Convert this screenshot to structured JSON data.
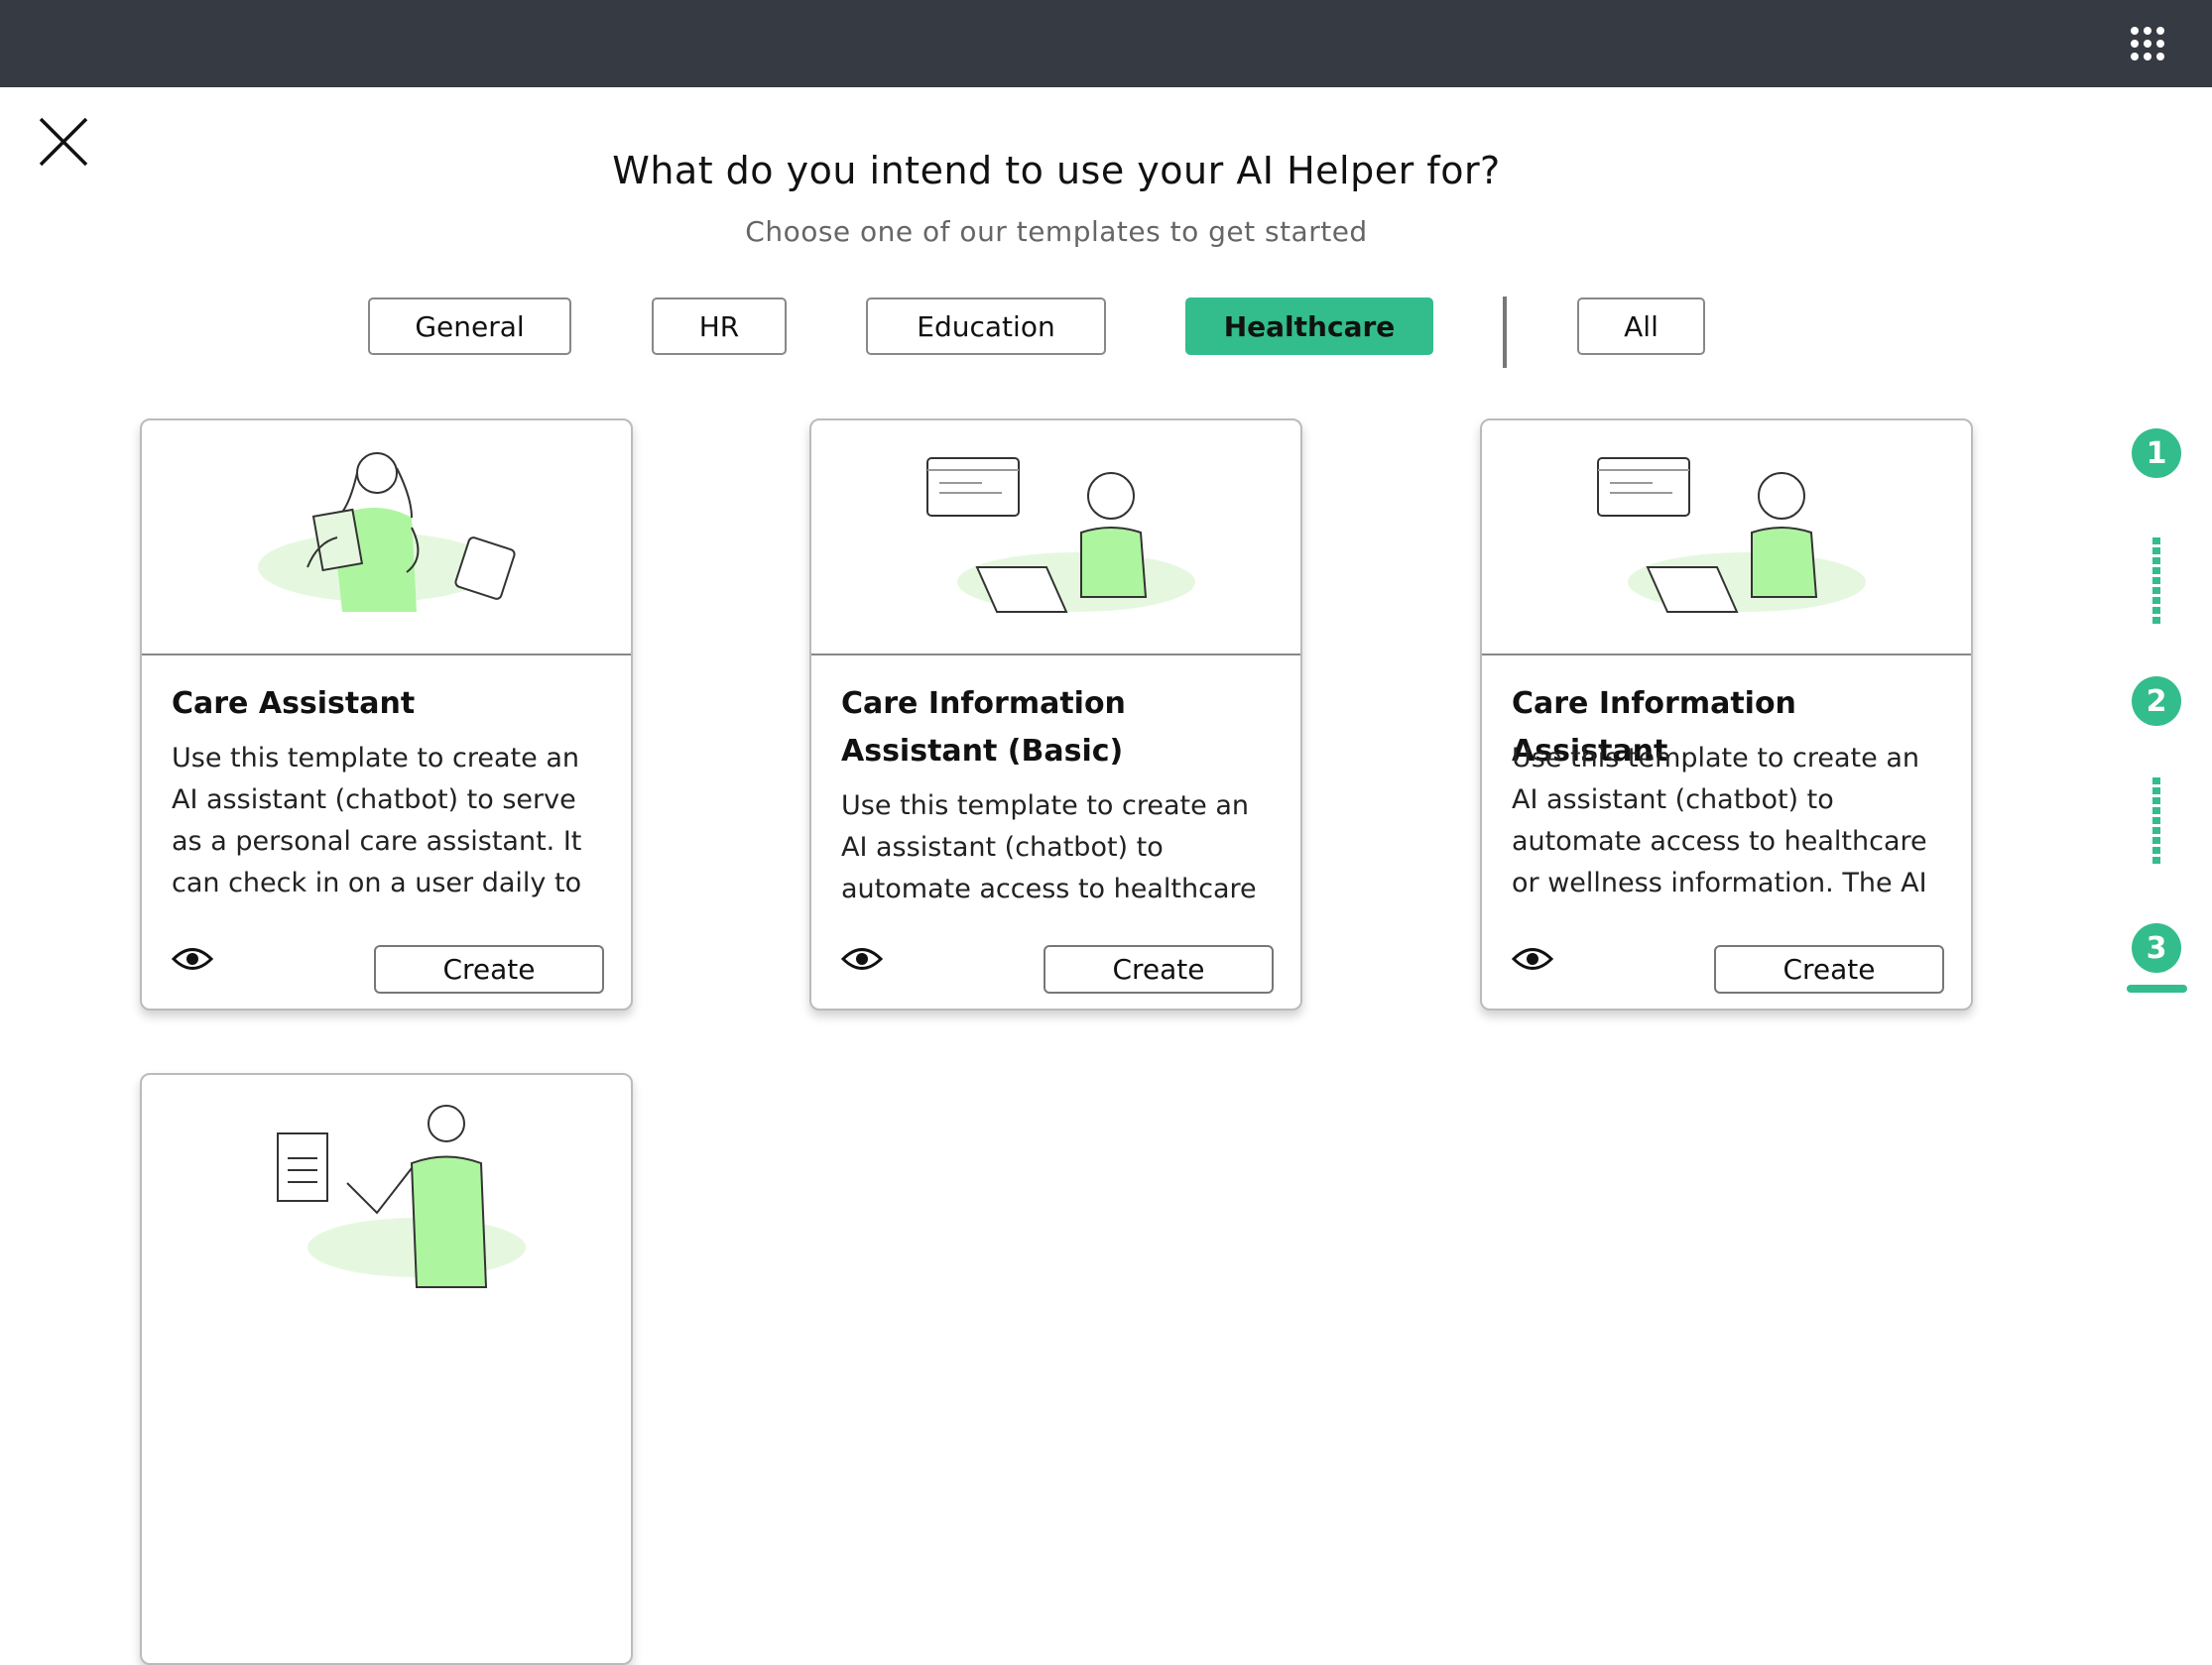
{
  "header": {
    "apps_icon": "grid-dots-icon"
  },
  "close_icon": "close-x-icon",
  "title": "What do you intend to use your AI Helper for?",
  "subtitle": "Choose one of our templates to get started",
  "filters": [
    {
      "label": "General",
      "active": false
    },
    {
      "label": "HR",
      "active": false
    },
    {
      "label": "Education",
      "active": false
    },
    {
      "label": "Healthcare",
      "active": true
    },
    {
      "label": "All",
      "active": false
    }
  ],
  "accent_color": "#33bd8c",
  "cards": [
    {
      "title": "Care Assistant",
      "description": "Use this template to create an AI assistant (chatbot) to serve as a personal care assistant. It can check in on a user daily to",
      "create_label": "Create",
      "preview_icon": "eye-icon"
    },
    {
      "title": "Care Information Assistant (Basic)",
      "description": "Use this template to create an AI assistant (chatbot) to automate access to healthcare",
      "create_label": "Create",
      "preview_icon": "eye-icon"
    },
    {
      "title": "Care Information Assistant",
      "description": "Use this template to create an AI assistant (chatbot) to automate access to healthcare or wellness information. The AI",
      "create_label": "Create",
      "preview_icon": "eye-icon"
    }
  ],
  "steps": [
    {
      "label": "1"
    },
    {
      "label": "2"
    },
    {
      "label": "3",
      "current": true
    }
  ]
}
